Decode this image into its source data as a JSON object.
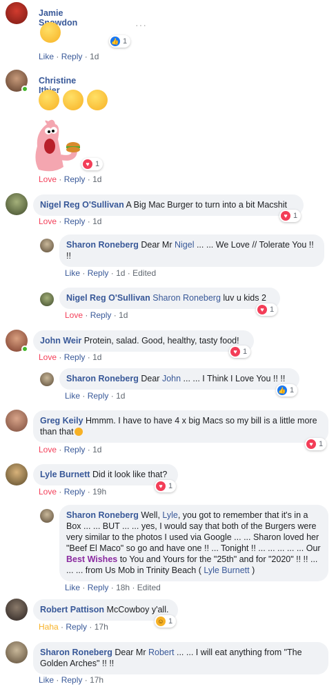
{
  "comments": [
    {
      "name": "Jamie Snowdon",
      "text": "",
      "actions": [
        "Like",
        "Reply",
        "1d"
      ],
      "reaction": {
        "type": "like",
        "count": "1"
      }
    },
    {
      "name": "Christine Ithier",
      "text": "",
      "actions": [
        "Love",
        "Reply",
        "1d"
      ],
      "reaction": {
        "type": "love",
        "count": "1"
      }
    },
    {
      "name": "Nigel Reg O'Sullivan",
      "text": "A Big Mac Burger to turn into a bit Macshit",
      "actions": [
        "Love",
        "Reply",
        "1d"
      ],
      "reaction": {
        "type": "love",
        "count": "1"
      }
    },
    {
      "name": "Sharon Roneberg",
      "text_pre": "Dear Mr ",
      "mention": "Nigel",
      "text_post": " ... ... We Love // Tolerate You !! !!",
      "actions": [
        "Like",
        "Reply",
        "1d",
        "Edited"
      ]
    },
    {
      "name": "Nigel Reg O'Sullivan",
      "mention": "Sharon Roneberg",
      "text_post": " luv u kids 2",
      "actions": [
        "Love",
        "Reply",
        "1d"
      ],
      "reaction": {
        "type": "love",
        "count": "1"
      }
    },
    {
      "name": "John Weir",
      "text": "Protein, salad. Good, healthy, tasty food!",
      "actions": [
        "Love",
        "Reply",
        "1d"
      ],
      "reaction": {
        "type": "love",
        "count": "1"
      }
    },
    {
      "name": "Sharon Roneberg",
      "text_pre": "Dear ",
      "mention": "John",
      "text_post": " ... ... I Think I Love You !! !!",
      "actions": [
        "Like",
        "Reply",
        "1d"
      ],
      "reaction": {
        "type": "like",
        "count": "1"
      }
    },
    {
      "name": "Greg Keily",
      "text": "Hmmm. I have to have 4 x big Macs so my bill is a little more than that",
      "actions": [
        "Love",
        "Reply",
        "1d"
      ],
      "reaction": {
        "type": "love",
        "count": "1"
      }
    },
    {
      "name": "Lyle Burnett",
      "text": "Did it look like that?",
      "actions": [
        "Love",
        "Reply",
        "19h"
      ],
      "reaction": {
        "type": "love",
        "count": "1"
      }
    },
    {
      "name": "Sharon Roneberg",
      "t1": "Well, ",
      "m1": "Lyle",
      "t2": ", you got to remember that it's in a Box ... ... BUT ... ... yes, I would say that both of the Burgers were very similar to the photos I used via Google ... ... Sharon loved her \"Beef El Maco\" so go and have one !! ... Tonight !! ... ... ... ... ... Our ",
      "m2": "Best Wishes",
      "t3": " to You and Yours for the \"25th\" and for \"2020\" !! !! ... ... ... from Us Mob in Trinity Beach ( ",
      "m3": "Lyle Burnett",
      "t4": " )",
      "actions": [
        "Like",
        "Reply",
        "18h",
        "Edited"
      ]
    },
    {
      "name": "Robert Pattison",
      "text": "McCowboy y'all.",
      "actions": [
        "Haha",
        "Reply",
        "17h"
      ],
      "reaction": {
        "type": "haha",
        "count": "1"
      }
    },
    {
      "name": "Sharon Roneberg",
      "text_pre": "Dear Mr ",
      "mention": "Robert",
      "text_post": " ... ... I will eat anything from \"The Golden Arches\" !! !!",
      "actions": [
        "Like",
        "Reply",
        "17h"
      ]
    }
  ],
  "separator": "·",
  "more_icon": "···"
}
